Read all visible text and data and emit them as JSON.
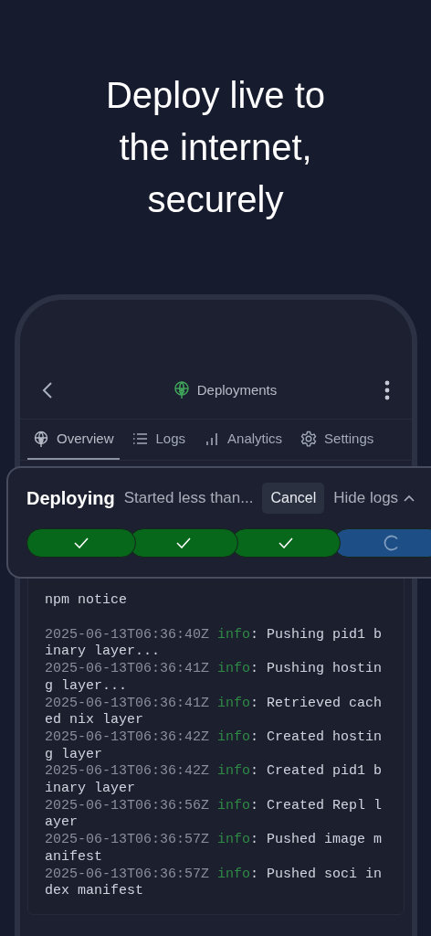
{
  "headline": "Deploy live to the internet, securely",
  "nav": {
    "title": "Deployments"
  },
  "tabs": [
    {
      "label": "Overview",
      "selected": true
    },
    {
      "label": "Logs",
      "selected": false
    },
    {
      "label": "Analytics",
      "selected": false
    },
    {
      "label": "Settings",
      "selected": false
    }
  ],
  "deploy_panel": {
    "status": "Deploying",
    "subtitle": "Started less than...",
    "cancel_button": "Cancel",
    "toggle_logs": "Hide logs",
    "steps": [
      {
        "kind": "done"
      },
      {
        "kind": "done"
      },
      {
        "kind": "done"
      },
      {
        "kind": "running"
      }
    ]
  },
  "logs": [
    {
      "message": "npm notice"
    },
    {
      "timestamp": "2025-06-13T06:36:40Z",
      "level": "info",
      "message": ": Pushing pid1 binary layer..."
    },
    {
      "timestamp": "2025-06-13T06:36:41Z",
      "level": "info",
      "message": ": Pushing hosting layer..."
    },
    {
      "timestamp": "2025-06-13T06:36:41Z",
      "level": "info",
      "message": ": Retrieved cached nix layer"
    },
    {
      "timestamp": "2025-06-13T06:36:42Z",
      "level": "info",
      "message": ": Created hosting layer"
    },
    {
      "timestamp": "2025-06-13T06:36:42Z",
      "level": "info",
      "message": ": Created pid1 binary layer"
    },
    {
      "timestamp": "2025-06-13T06:36:56Z",
      "level": "info",
      "message": ": Created Repl layer"
    },
    {
      "timestamp": "2025-06-13T06:36:57Z",
      "level": "info",
      "message": ": Pushed image manifest"
    },
    {
      "timestamp": "2025-06-13T06:36:57Z",
      "level": "info",
      "message": ": Pushed soci index manifest"
    }
  ]
}
